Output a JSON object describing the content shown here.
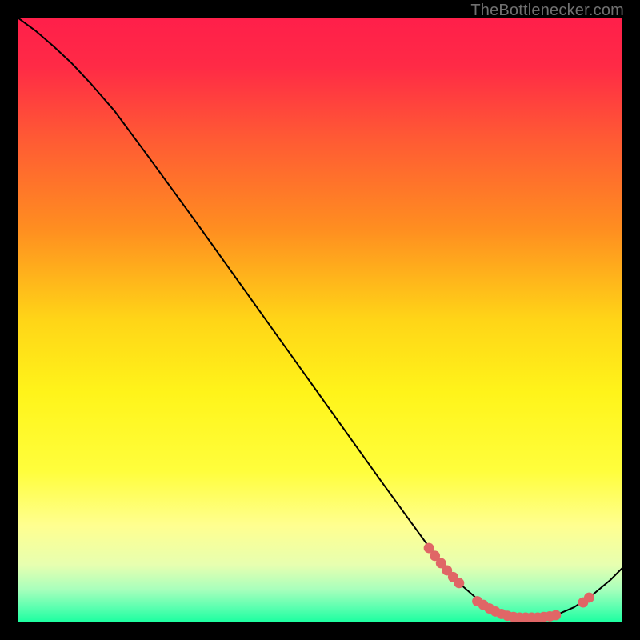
{
  "watermark": "TheBottlenecker.com",
  "chart_data": {
    "type": "line",
    "title": "",
    "xlabel": "",
    "ylabel": "",
    "xlim": [
      0,
      100
    ],
    "ylim": [
      0,
      100
    ],
    "background_gradient_stops": [
      {
        "offset": 0.0,
        "color": "#ff1f4a"
      },
      {
        "offset": 0.08,
        "color": "#ff2a46"
      },
      {
        "offset": 0.2,
        "color": "#ff5a34"
      },
      {
        "offset": 0.35,
        "color": "#ff8e20"
      },
      {
        "offset": 0.5,
        "color": "#ffd517"
      },
      {
        "offset": 0.62,
        "color": "#fff41a"
      },
      {
        "offset": 0.75,
        "color": "#fffe3c"
      },
      {
        "offset": 0.84,
        "color": "#ffff90"
      },
      {
        "offset": 0.905,
        "color": "#e7ffb0"
      },
      {
        "offset": 0.945,
        "color": "#a9ffbc"
      },
      {
        "offset": 0.975,
        "color": "#5cffb0"
      },
      {
        "offset": 1.0,
        "color": "#1affa0"
      }
    ],
    "series": [
      {
        "name": "bottleneck-curve",
        "type": "path",
        "points": [
          {
            "x": 0,
            "y": 100.0
          },
          {
            "x": 3,
            "y": 97.8
          },
          {
            "x": 6,
            "y": 95.2
          },
          {
            "x": 9,
            "y": 92.4
          },
          {
            "x": 12,
            "y": 89.2
          },
          {
            "x": 16,
            "y": 84.6
          },
          {
            "x": 22,
            "y": 76.5
          },
          {
            "x": 30,
            "y": 65.5
          },
          {
            "x": 40,
            "y": 51.5
          },
          {
            "x": 50,
            "y": 37.5
          },
          {
            "x": 60,
            "y": 23.5
          },
          {
            "x": 68,
            "y": 12.5
          },
          {
            "x": 73,
            "y": 6.5
          },
          {
            "x": 77,
            "y": 3.0
          },
          {
            "x": 80,
            "y": 1.4
          },
          {
            "x": 83,
            "y": 0.8
          },
          {
            "x": 86,
            "y": 0.8
          },
          {
            "x": 89,
            "y": 1.2
          },
          {
            "x": 92,
            "y": 2.5
          },
          {
            "x": 95,
            "y": 4.5
          },
          {
            "x": 98,
            "y": 7.0
          },
          {
            "x": 100,
            "y": 9.0
          }
        ]
      },
      {
        "name": "highlight-dots",
        "type": "scatter",
        "color": "#e06666",
        "points": [
          {
            "x": 68.0,
            "y": 12.3
          },
          {
            "x": 69.0,
            "y": 11.0
          },
          {
            "x": 70.0,
            "y": 9.8
          },
          {
            "x": 71.0,
            "y": 8.6
          },
          {
            "x": 72.0,
            "y": 7.5
          },
          {
            "x": 73.0,
            "y": 6.5
          },
          {
            "x": 76.0,
            "y": 3.5
          },
          {
            "x": 77.0,
            "y": 2.9
          },
          {
            "x": 78.0,
            "y": 2.3
          },
          {
            "x": 79.0,
            "y": 1.8
          },
          {
            "x": 80.0,
            "y": 1.4
          },
          {
            "x": 81.0,
            "y": 1.1
          },
          {
            "x": 82.0,
            "y": 0.9
          },
          {
            "x": 83.0,
            "y": 0.8
          },
          {
            "x": 84.0,
            "y": 0.8
          },
          {
            "x": 85.0,
            "y": 0.8
          },
          {
            "x": 86.0,
            "y": 0.8
          },
          {
            "x": 87.0,
            "y": 0.9
          },
          {
            "x": 88.0,
            "y": 1.0
          },
          {
            "x": 89.0,
            "y": 1.2
          },
          {
            "x": 93.5,
            "y": 3.3
          },
          {
            "x": 94.5,
            "y": 4.1
          }
        ]
      }
    ]
  }
}
